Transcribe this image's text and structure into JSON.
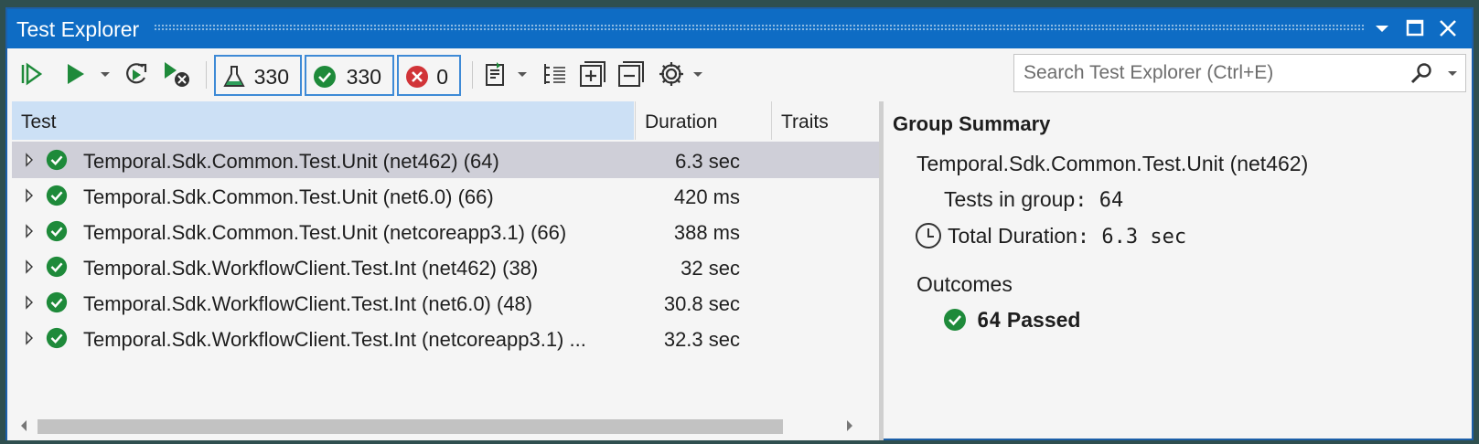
{
  "window": {
    "title": "Test Explorer"
  },
  "toolbar": {
    "counts": {
      "total": "330",
      "passed": "330",
      "failed": "0"
    },
    "search": {
      "placeholder": "Search Test Explorer (Ctrl+E)"
    },
    "icons": [
      "run-all-icon",
      "run-icon",
      "repeat-last-run-icon",
      "cancel-run-icon",
      "flask-icon",
      "playlist-icon",
      "hierarchy-icon",
      "expand-all-icon",
      "collapse-all-icon",
      "gear-icon",
      "search-icon"
    ]
  },
  "columns": {
    "test": "Test",
    "duration": "Duration",
    "traits": "Traits"
  },
  "tests": [
    {
      "name": "Temporal.Sdk.Common.Test.Unit (net462)  (64)",
      "duration": "6.3 sec"
    },
    {
      "name": "Temporal.Sdk.Common.Test.Unit (net6.0)  (66)",
      "duration": "420 ms"
    },
    {
      "name": "Temporal.Sdk.Common.Test.Unit (netcoreapp3.1)  (66)",
      "duration": "388 ms"
    },
    {
      "name": "Temporal.Sdk.WorkflowClient.Test.Int (net462)  (38)",
      "duration": "32 sec"
    },
    {
      "name": "Temporal.Sdk.WorkflowClient.Test.Int (net6.0)  (48)",
      "duration": "30.8 sec"
    },
    {
      "name": "Temporal.Sdk.WorkflowClient.Test.Int (netcoreapp3.1)  ...",
      "duration": "32.3 sec"
    }
  ],
  "summary": {
    "title": "Group Summary",
    "group_name": "Temporal.Sdk.Common.Test.Unit (net462)",
    "tests_label": "Tests in group",
    "tests_value": "64",
    "duration_label": "Total Duration",
    "duration_value": "6.3 sec",
    "outcomes_label": "Outcomes",
    "passed_count": "64",
    "passed_label": "Passed"
  },
  "colors": {
    "accent": "#0e6cc4",
    "pass": "#1e8a3a",
    "fail": "#d13438",
    "selection": "#cfcfd8"
  }
}
